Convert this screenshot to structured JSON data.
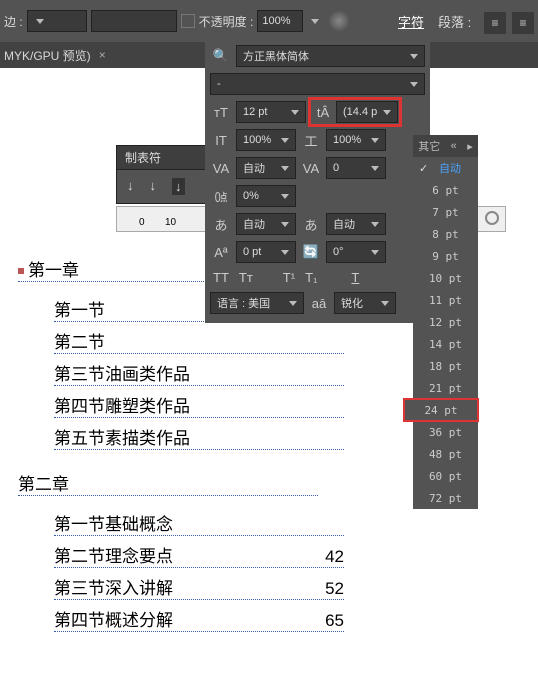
{
  "topbar": {
    "stroke_label": "边 :",
    "stroke_value": "",
    "opacity_label": "不透明度 :",
    "opacity_value": "100%"
  },
  "panels": {
    "char_tab": "字符",
    "para_tab": "段落 :"
  },
  "tab": {
    "title": "MYK/GPU 预览)",
    "close": "×"
  },
  "tabstops": {
    "title": "制表符",
    "ruler_marks": [
      "0",
      "10"
    ]
  },
  "char": {
    "font_family": "方正黑体简体",
    "font_style": "-",
    "size": "12 pt",
    "leading": "(14.4 p",
    "hscale": "100%",
    "vscale": "100%",
    "tracking_mode": "自动",
    "kerning": "0",
    "baseline": "0%",
    "tsume": "自动",
    "aki": "自动",
    "shift": "0 pt",
    "rotate": "0°",
    "lang": "语言 : 美国",
    "aa": "锐化"
  },
  "dropdown": {
    "header": "其它",
    "auto": "自动",
    "items": [
      "6 pt",
      "7 pt",
      "8 pt",
      "9 pt",
      "10 pt",
      "11 pt",
      "12 pt",
      "14 pt",
      "18 pt",
      "21 pt",
      "24 pt",
      "36 pt",
      "48 pt",
      "60 pt",
      "72 pt"
    ],
    "selected": "24 pt"
  },
  "toc": {
    "ch1": "第一章",
    "ch1_items": [
      {
        "t": "第一节",
        "pg": ""
      },
      {
        "t": "第二节",
        "pg": ""
      },
      {
        "t": "第三节油画类作品",
        "pg": ""
      },
      {
        "t": "第四节雕塑类作品",
        "pg": ""
      },
      {
        "t": "第五节素描类作品",
        "pg": ""
      }
    ],
    "ch2": "第二章",
    "ch2_items": [
      {
        "t": "第一节基础概念",
        "pg": ""
      },
      {
        "t": "第二节理念要点",
        "pg": "42"
      },
      {
        "t": "第三节深入讲解",
        "pg": "52"
      },
      {
        "t": "第四节概述分解",
        "pg": "65"
      }
    ]
  }
}
